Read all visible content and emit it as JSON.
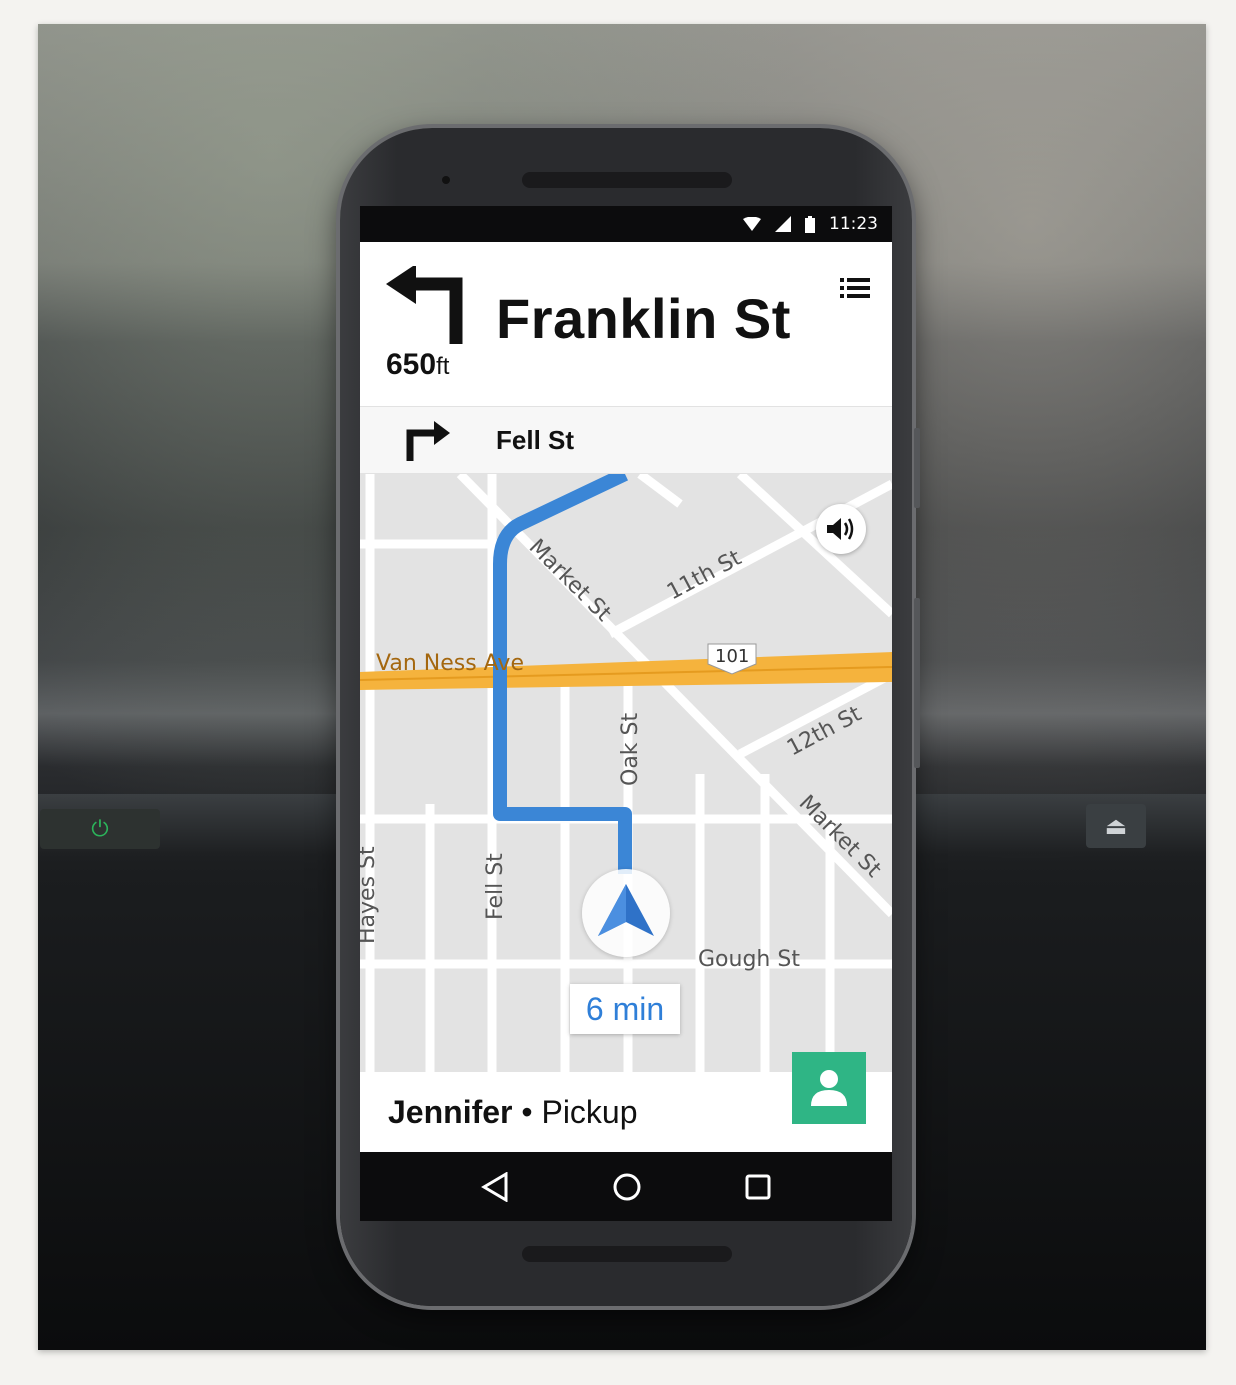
{
  "status_bar": {
    "time": "11:23"
  },
  "header": {
    "distance_value": "650",
    "distance_unit": "ft",
    "street": "Franklin St"
  },
  "next_turn": {
    "street": "Fell St"
  },
  "map": {
    "labels": {
      "market_st_1": "Market St",
      "eleventh_st": "11th St",
      "van_ness": "Van Ness Ave",
      "hwy_101": "101",
      "oak_st": "Oak St",
      "twelfth_st": "12th St",
      "market_st_2": "Market St",
      "hayes_st": "Hayes St",
      "fell_st": "Fell St",
      "gough_st": "Gough St"
    },
    "eta": "6 min"
  },
  "trip": {
    "rider_name": "Jennifer",
    "separator": "•",
    "status": "Pickup"
  },
  "colors": {
    "route": "#3b86d6",
    "highway": "#f5b33d",
    "contact": "#2fb585"
  },
  "icons": [
    "wifi-icon",
    "signal-icon",
    "battery-icon",
    "turn-left-icon",
    "menu-icon",
    "turn-right-icon",
    "sound-icon",
    "navigation-arrow-icon",
    "person-icon",
    "back-icon",
    "home-icon",
    "recents-icon"
  ]
}
